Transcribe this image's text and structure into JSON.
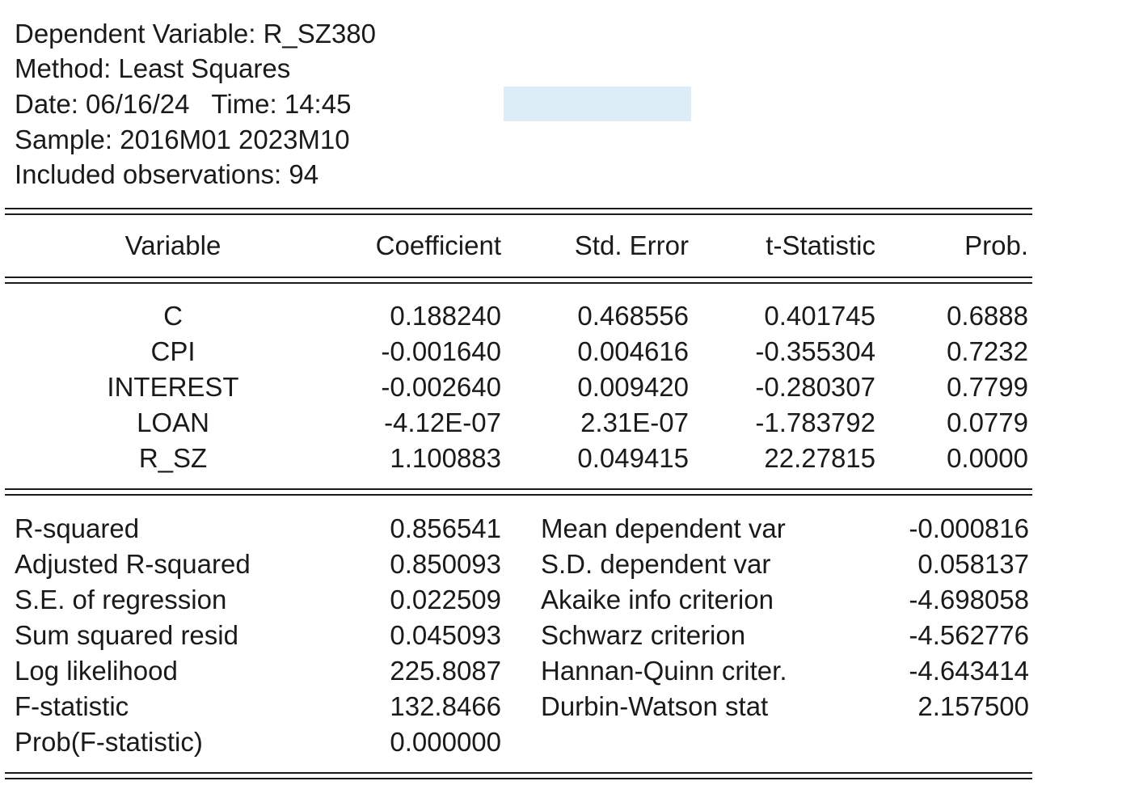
{
  "header": {
    "dependent_variable": "Dependent Variable: R_SZ380",
    "method": "Method: Least Squares",
    "date_time": "Date: 06/16/24   Time: 14:45",
    "sample": "Sample: 2016M01 2023M10",
    "observations": "Included observations: 94"
  },
  "highlight_color": "#dcedf8",
  "columns": [
    "Variable",
    "Coefficient",
    "Std. Error",
    "t-Statistic",
    "Prob."
  ],
  "rows": [
    [
      "C",
      "0.188240",
      "0.468556",
      "0.401745",
      "0.6888"
    ],
    [
      "CPI",
      "-0.001640",
      "0.004616",
      "-0.355304",
      "0.7232"
    ],
    [
      "INTEREST",
      "-0.002640",
      "0.009420",
      "-0.280307",
      "0.7799"
    ],
    [
      "LOAN",
      "-4.12E-07",
      "2.31E-07",
      "-1.783792",
      "0.0779"
    ],
    [
      "R_SZ",
      "1.100883",
      "0.049415",
      "22.27815",
      "0.0000"
    ]
  ],
  "stats_left": [
    [
      "R-squared",
      "0.856541"
    ],
    [
      "Adjusted R-squared",
      "0.850093"
    ],
    [
      "S.E. of regression",
      "0.022509"
    ],
    [
      "Sum squared resid",
      "0.045093"
    ],
    [
      "Log likelihood",
      "225.8087"
    ],
    [
      "F-statistic",
      "132.8466"
    ],
    [
      "Prob(F-statistic)",
      "0.000000"
    ]
  ],
  "stats_right": [
    [
      "Mean dependent var",
      "-0.000816"
    ],
    [
      "S.D. dependent var",
      "0.058137"
    ],
    [
      "Akaike info criterion",
      "-4.698058"
    ],
    [
      "Schwarz criterion",
      "-4.562776"
    ],
    [
      "Hannan-Quinn criter.",
      "-4.643414"
    ],
    [
      "Durbin-Watson stat",
      "2.157500"
    ]
  ]
}
